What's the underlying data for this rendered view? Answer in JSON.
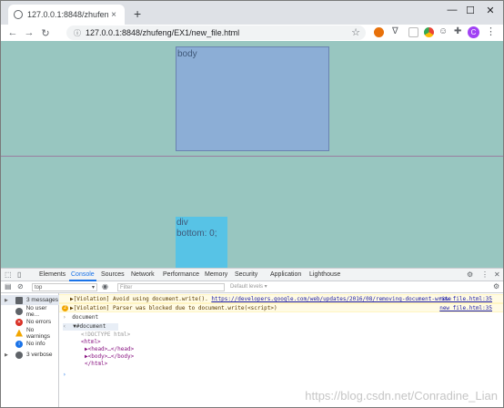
{
  "browser": {
    "tab_title": "127.0.0.1:8848/zhufeng/EX1/...",
    "tab_close": "×",
    "new_tab": "+",
    "win_min": "—",
    "win_max": "☐",
    "win_close": "✕",
    "url": "127.0.0.1:8848/zhufeng/EX1/new_file.html",
    "avatar_letter": "C"
  },
  "page": {
    "body_label": "body",
    "div_label_1": "div",
    "div_label_2": "bottom: 0;"
  },
  "devtools": {
    "tabs": [
      "Elements",
      "Console",
      "Sources",
      "Network",
      "Performance",
      "Memory",
      "Security",
      "Application",
      "Lighthouse"
    ],
    "context": "top",
    "filter_placeholder": "Filter",
    "levels": "Default levels ▾",
    "sidebar": {
      "messages": "3 messages",
      "user": "No user me...",
      "errors": "No errors",
      "warnings": "No warnings",
      "info": "No info",
      "verbose": "3 verbose"
    },
    "console": {
      "warn1_prefix": "▶[Violation] Avoid using document.write(). ",
      "warn1_link": "https://developers.google.com/web/updates/2016/08/removing-document-write",
      "warn1_src": "new_file.html:35",
      "warn2_badge": "2",
      "warn2_text": "▶[Violation] Parser was blocked due to document.write(<script>)",
      "warn2_src": "new_file.html:35",
      "cmd": "document",
      "result": "▼#document",
      "doctype": "<!DOCTYPE html>",
      "html_open": "<html>",
      "head": "▶<head>…</head>",
      "body": "▶<body>…</body>",
      "html_close": "</html>",
      "prompt": "›"
    }
  },
  "watermark": "https://blog.csdn.net/Conradine_Lian"
}
